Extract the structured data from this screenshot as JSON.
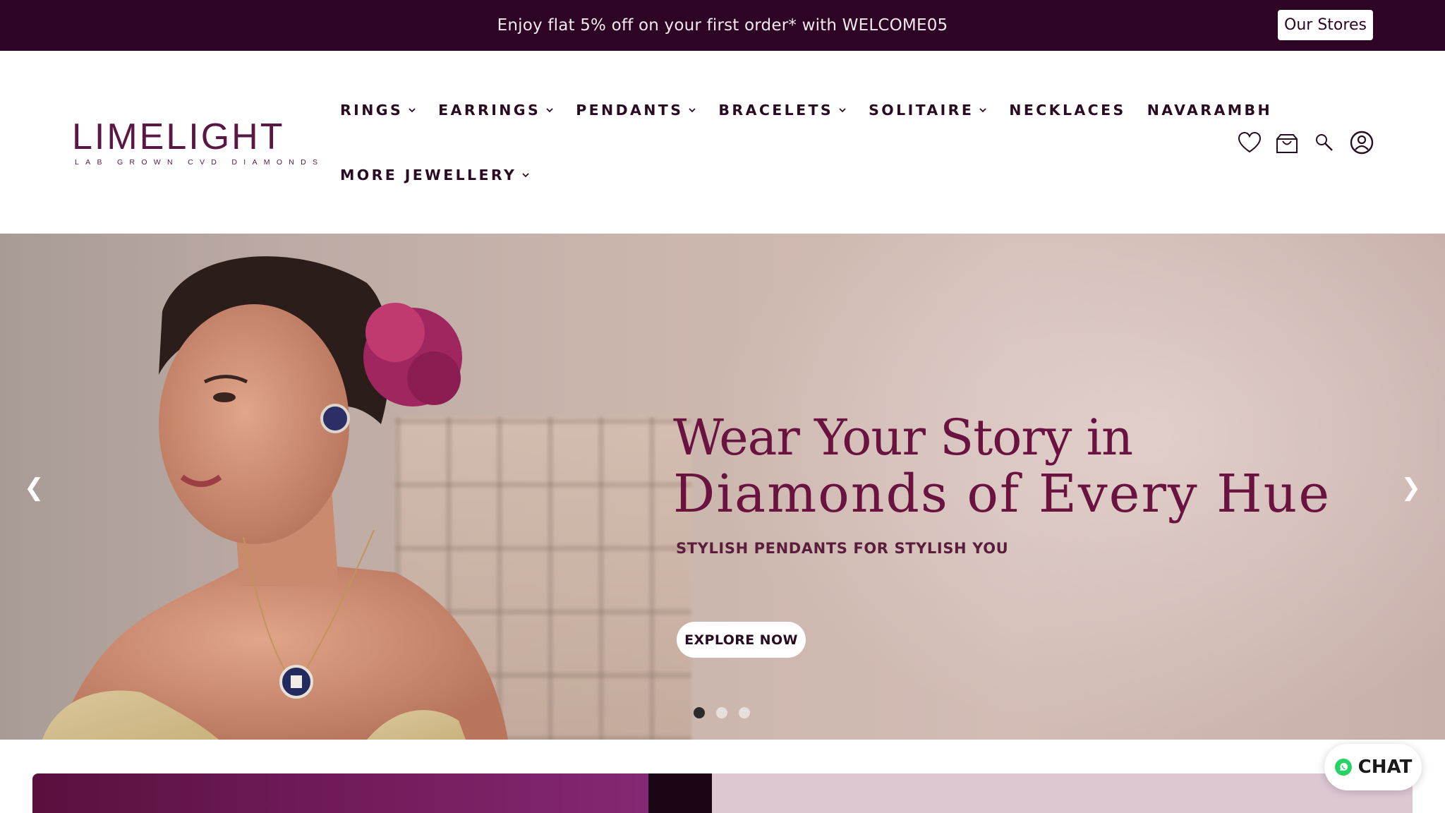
{
  "announcement": {
    "text": "Enjoy flat 5% off on your first order* with WELCOME05",
    "stores_button": "Our Stores",
    "background": "#2d0423"
  },
  "logo": {
    "word": "LIMELIGHT",
    "subtitle": "LAB GROWN CVD DIAMONDS",
    "color": "#5a1744"
  },
  "nav": {
    "row1": [
      {
        "label": "RINGS",
        "has_dropdown": true
      },
      {
        "label": "EARRINGS",
        "has_dropdown": true
      },
      {
        "label": "PENDANTS",
        "has_dropdown": true
      },
      {
        "label": "BRACELETS",
        "has_dropdown": true
      },
      {
        "label": "SOLITAIRE",
        "has_dropdown": true
      },
      {
        "label": "NECKLACES",
        "has_dropdown": false
      },
      {
        "label": "NAVARAMBH",
        "has_dropdown": false
      }
    ],
    "row2": [
      {
        "label": "MORE JEWELLERY",
        "has_dropdown": true
      }
    ]
  },
  "header_icons": [
    "heart-icon",
    "shopping-bag-icon",
    "search-icon",
    "account-icon"
  ],
  "hero": {
    "headline_line1": "Wear Your Story in",
    "headline_line2": "Diamonds of Every Hue",
    "subhead": "STYLISH PENDANTS FOR STYLISH YOU",
    "cta": "EXPLORE NOW",
    "prev_arrow": "❮",
    "next_arrow": "❯",
    "slide_count": 3,
    "active_slide": 1,
    "headline_color": "#6a1340"
  },
  "chat": {
    "label": "CHAT",
    "icon": "whatsapp-icon"
  }
}
